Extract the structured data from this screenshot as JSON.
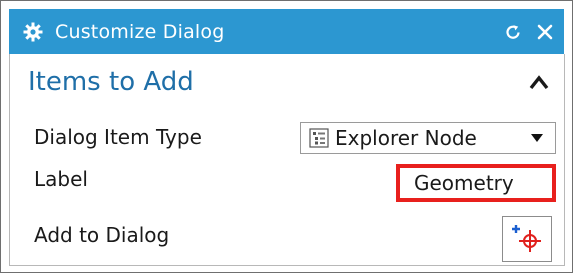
{
  "dialog": {
    "title": "Customize Dialog",
    "titlebar_color": "#2c97d1"
  },
  "group": {
    "title": "Items to Add",
    "title_color": "#1f6fa8"
  },
  "rows": [
    {
      "label": "Dialog Item Type",
      "control": "dropdown",
      "value": "Explorer Node",
      "icon": "explorer-node-icon"
    },
    {
      "label": "Label",
      "control": "text-field",
      "value": "Geometry",
      "highlight_color": "#e8201d"
    },
    {
      "label": "Add to Dialog",
      "control": "button",
      "icon": "add-point-icon"
    }
  ],
  "icons": {
    "title": "gear-icon",
    "reset": "reset-icon",
    "close": "close-icon",
    "collapse": "chevron-up-icon",
    "dropdown_caret": "caret-down-icon"
  }
}
